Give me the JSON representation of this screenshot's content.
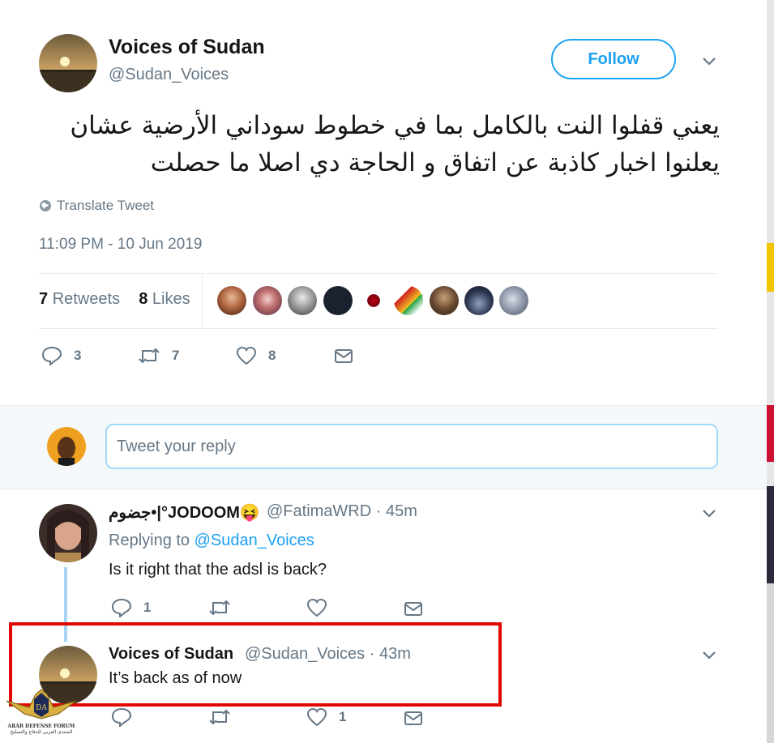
{
  "tweet": {
    "name": "Voices of Sudan",
    "handle": "@Sudan_Voices",
    "follow_label": "Follow",
    "text_line1": "يعني قفلوا النت بالكامل بما في خطوط سوداني الأرضية عشان",
    "text_line2": "يعلنوا اخبار كاذبة عن اتفاق و الحاجة دي اصلا ما حصلت",
    "translate_label": "Translate Tweet",
    "timestamp": "11:09 PM - 10 Jun 2019",
    "retweets_count": "7",
    "retweets_label": "Retweets",
    "likes_count": "8",
    "likes_label": "Likes",
    "actions": {
      "replies": "3",
      "retweets": "7",
      "likes": "8"
    }
  },
  "reply_box": {
    "placeholder": "Tweet your reply"
  },
  "replies": [
    {
      "name": "جضوم•|°JODOOM😝",
      "handle": "@FatimaWRD",
      "time": "· 45m",
      "replying_prefix": "Replying to",
      "replying_to": "@Sudan_Voices",
      "text": "Is it right that the adsl is back?",
      "actions": {
        "replies": "1",
        "retweets": "",
        "likes": ""
      }
    },
    {
      "name": "Voices of Sudan",
      "handle": "@Sudan_Voices",
      "time": "· 43m",
      "text": "It’s back as of now",
      "actions": {
        "replies": "",
        "retweets": "",
        "likes": "1"
      }
    }
  ],
  "watermark": {
    "line1": "ARAB DEFENSE FORUM",
    "line2": "المنتدى العربي للدفاع والتسليح",
    "logo_text": "DA"
  },
  "colors": {
    "accent": "#1da1f2",
    "highlight": "#e10600",
    "muted": "#657786"
  },
  "icons": [
    "globe-icon",
    "chevron-down-icon",
    "reply-icon",
    "retweet-icon",
    "heart-icon",
    "mail-icon"
  ]
}
